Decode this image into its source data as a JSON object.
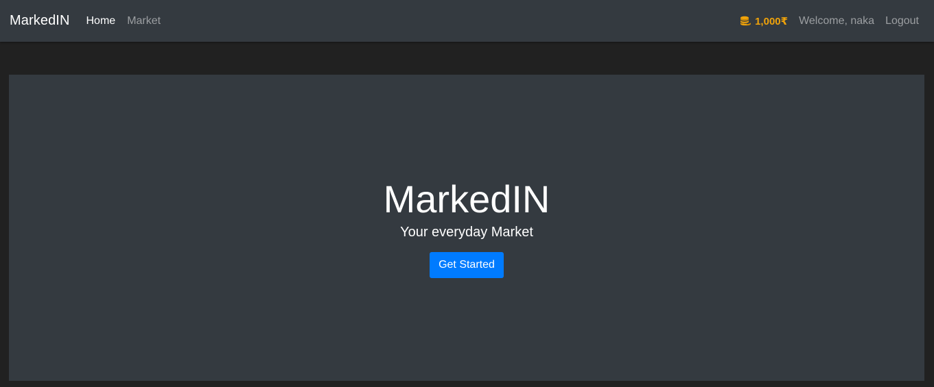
{
  "navbar": {
    "brand": "MarkedIN",
    "links": [
      {
        "label": "Home",
        "active": true
      },
      {
        "label": "Market",
        "active": false
      }
    ],
    "balance": {
      "icon": "coins-icon",
      "amount": "1,000₹",
      "color": "#f0a30a"
    },
    "welcome": "Welcome, naka",
    "logout": "Logout"
  },
  "hero": {
    "title": "MarkedIN",
    "subtitle": "Your everyday Market",
    "button_label": "Get Started",
    "button_color": "#007bff"
  },
  "colors": {
    "page_background": "#212121",
    "panel_background": "#343a40"
  }
}
